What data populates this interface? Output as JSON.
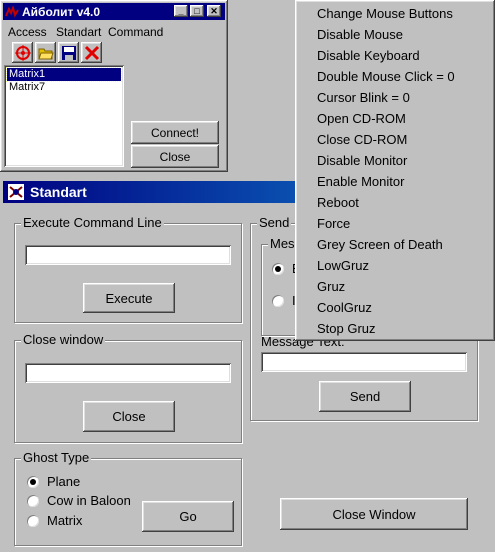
{
  "small_window": {
    "title": "Айболит v4.0",
    "menu": [
      "Access",
      "Standart",
      "Command"
    ],
    "list_items": [
      "Matrix1",
      "Matrix7"
    ],
    "connect_label": "Connect!",
    "close_label": "Close",
    "colors": {
      "title_bg": "#000080",
      "selection": "#000080"
    }
  },
  "main_window": {
    "title": "Standart",
    "execute_group": {
      "label": "Execute Command Line",
      "input_value": "",
      "button": "Execute"
    },
    "close_window_group": {
      "label": "Close window",
      "input_value": "",
      "button": "Close"
    },
    "ghost_group": {
      "label": "Ghost Type",
      "options": [
        {
          "label": "Plane",
          "selected": true
        },
        {
          "label": "Cow in Baloon",
          "selected": false
        },
        {
          "label": "Matrix",
          "selected": false
        }
      ],
      "go_button": "Go"
    },
    "send_group": {
      "label": "Send",
      "inner_label": "Mes",
      "radio_1_fragment": "В",
      "radio_2_fragment": "I",
      "message_label": "Message Text:",
      "message_value": "",
      "send_button": "Send"
    },
    "close_window_button": "Close Window"
  },
  "context_menu": {
    "items": [
      "Change Mouse Buttons",
      "Disable Mouse",
      "Disable Keyboard",
      "Double Mouse Click = 0",
      "Cursor Blink = 0",
      "Open CD-ROM",
      "Close CD-ROM",
      "Disable Monitor",
      "Enable Monitor",
      "Reboot",
      "Force",
      "Grey Screen of Death",
      "LowGruz",
      "Gruz",
      "CoolGruz",
      "Stop Gruz"
    ]
  }
}
